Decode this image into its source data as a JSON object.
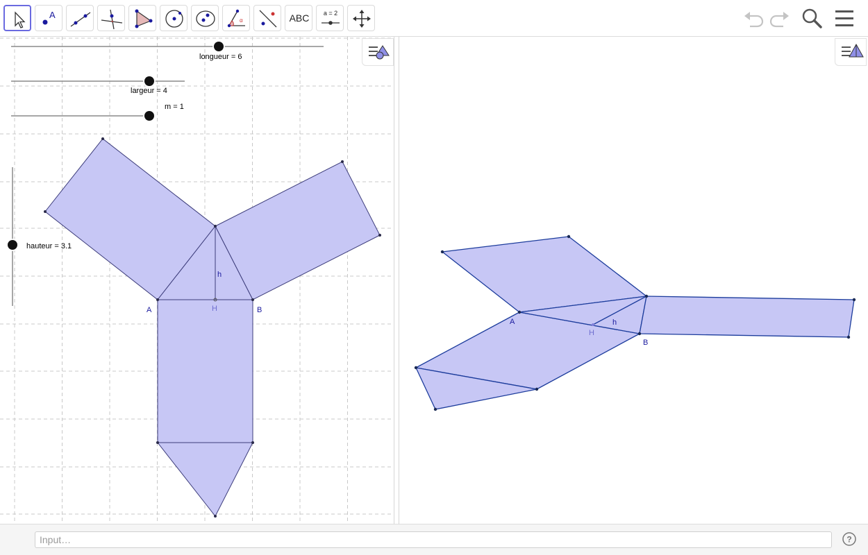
{
  "toolbar": {
    "tools": [
      {
        "name": "move-tool",
        "text": ""
      },
      {
        "name": "point-tool",
        "text": ""
      },
      {
        "name": "line-tool",
        "text": ""
      },
      {
        "name": "perpendicular-line-tool",
        "text": ""
      },
      {
        "name": "polygon-tool",
        "text": ""
      },
      {
        "name": "circle-tool",
        "text": ""
      },
      {
        "name": "ellipse-tool",
        "text": ""
      },
      {
        "name": "angle-tool",
        "text": ""
      },
      {
        "name": "reflect-tool",
        "text": ""
      },
      {
        "name": "text-tool",
        "text": "ABC"
      },
      {
        "name": "slider-tool",
        "text": "a = 2"
      },
      {
        "name": "move-graphics-tool",
        "text": ""
      }
    ],
    "icons": [
      "undo-icon",
      "redo-icon",
      "search-icon",
      "menu-icon"
    ]
  },
  "left_view": {
    "sliders": {
      "longueur": "longueur = 6",
      "largeur": "largeur = 4",
      "m": "m = 1",
      "hauteur": "hauteur = 3.1"
    },
    "labels": {
      "A": "A",
      "B": "B",
      "H": "H",
      "h": "h"
    }
  },
  "right_view": {
    "labels": {
      "A": "A",
      "B": "B",
      "H": "H",
      "h": "h"
    }
  },
  "colors": {
    "fill": "#c7c7f5",
    "stroke_left": "#3c3c7a",
    "stroke_right": "#1c3c9c",
    "label": "#1a1a9e",
    "active_tool": "#6a6ae0"
  },
  "input_bar": {
    "placeholder": "Input…",
    "help_icon": "help-icon"
  }
}
